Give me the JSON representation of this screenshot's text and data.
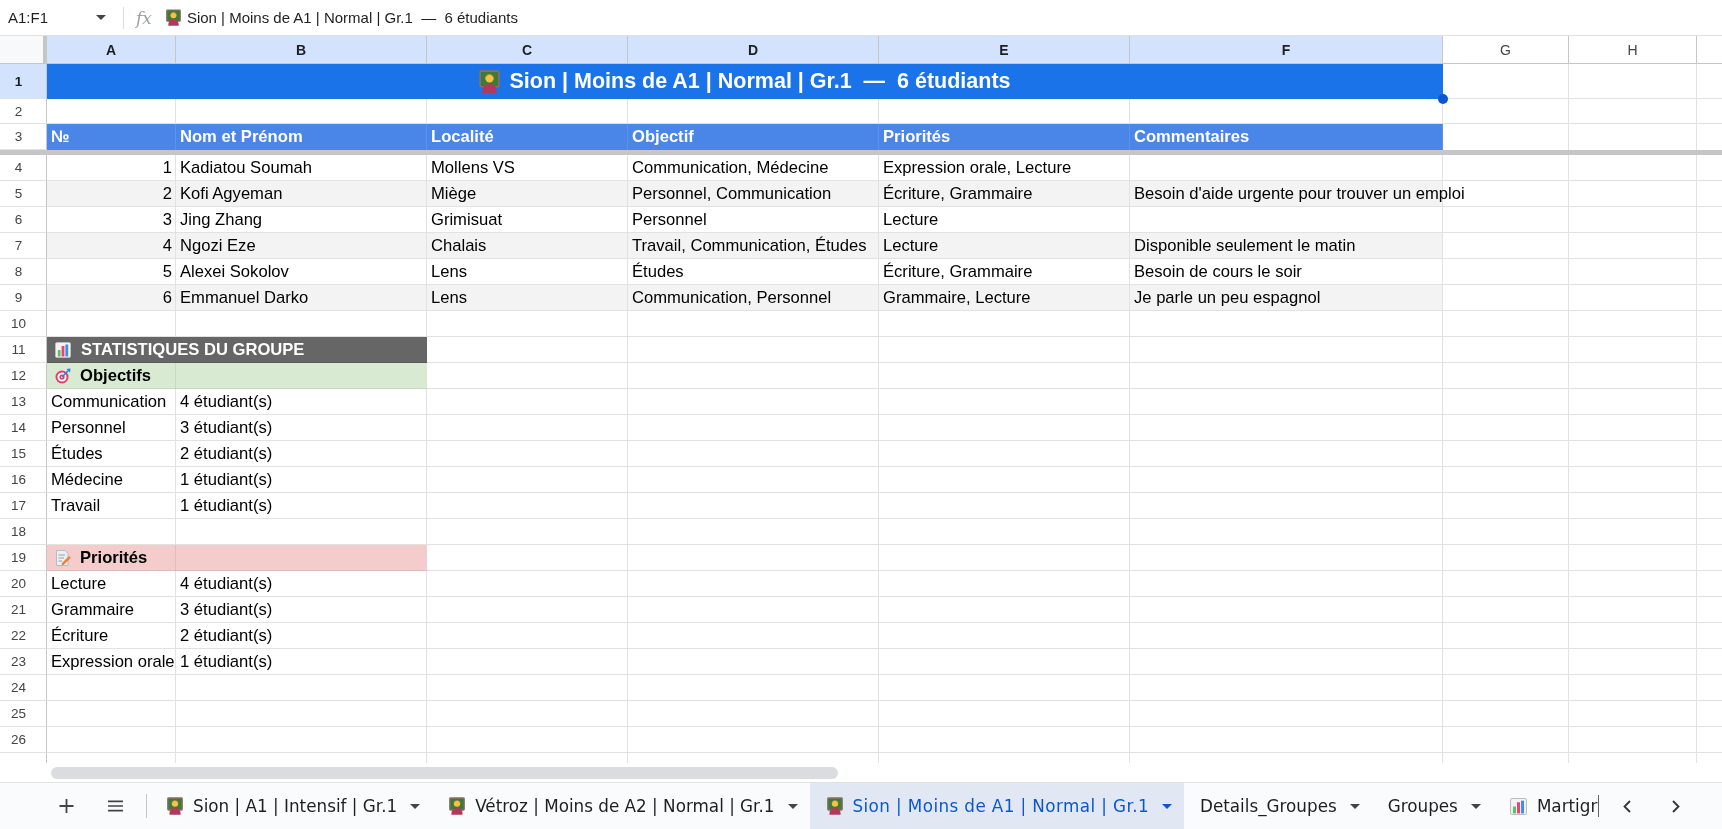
{
  "formula_bar": {
    "cell_reference": "A1:F1",
    "function_label": "fx",
    "content": "Sion | Moins de A1 | Normal | Gr.1  —  6 étudiants"
  },
  "column_headers": [
    {
      "label": "A",
      "selected": true
    },
    {
      "label": "B",
      "selected": true
    },
    {
      "label": "C",
      "selected": true
    },
    {
      "label": "D",
      "selected": true
    },
    {
      "label": "E",
      "selected": true
    },
    {
      "label": "F",
      "selected": true
    },
    {
      "label": "G",
      "selected": false
    },
    {
      "label": "H",
      "selected": false
    }
  ],
  "row_headers": [
    {
      "label": "1",
      "selected": true
    },
    {
      "label": "2",
      "selected": false
    },
    {
      "label": "3",
      "selected": false
    },
    {
      "label": "4",
      "selected": false
    },
    {
      "label": "5",
      "selected": false
    },
    {
      "label": "6",
      "selected": false
    },
    {
      "label": "7",
      "selected": false
    },
    {
      "label": "8",
      "selected": false
    },
    {
      "label": "9",
      "selected": false
    },
    {
      "label": "10",
      "selected": false
    },
    {
      "label": "11",
      "selected": false
    },
    {
      "label": "12",
      "selected": false
    },
    {
      "label": "13",
      "selected": false
    },
    {
      "label": "14",
      "selected": false
    },
    {
      "label": "15",
      "selected": false
    },
    {
      "label": "16",
      "selected": false
    },
    {
      "label": "17",
      "selected": false
    },
    {
      "label": "18",
      "selected": false
    },
    {
      "label": "19",
      "selected": false
    },
    {
      "label": "20",
      "selected": false
    },
    {
      "label": "21",
      "selected": false
    },
    {
      "label": "22",
      "selected": false
    },
    {
      "label": "23",
      "selected": false
    },
    {
      "label": "24",
      "selected": false
    },
    {
      "label": "25",
      "selected": false
    },
    {
      "label": "26",
      "selected": false
    }
  ],
  "title": "Sion | Moins de A1 | Normal | Gr.1  —  6 étudiants",
  "table": {
    "columns": [
      "№",
      "Nom et Prénom",
      "Localité",
      "Objectif",
      "Priorités",
      "Commentaires"
    ],
    "rows": [
      {
        "number": "1",
        "name": "Kadiatou Soumah",
        "locality": "Mollens VS",
        "objective": "Communication, Médecine",
        "priorities": "Expression orale, Lecture"
      },
      {
        "number": "2",
        "name": "Kofi Agyeman",
        "locality": "Miège",
        "objective": "Personnel, Communication",
        "priorities": "Écriture, Grammaire",
        "comment": "Besoin d'aide urgente pour trouver un emploi"
      },
      {
        "number": "3",
        "name": "Jing Zhang",
        "locality": "Grimisuat",
        "objective": "Personnel",
        "priorities": "Lecture"
      },
      {
        "number": "4",
        "name": "Ngozi Eze",
        "locality": "Chalais",
        "objective": "Travail, Communication, Études",
        "priorities": "Lecture",
        "comment": "Disponible seulement le matin"
      },
      {
        "number": "5",
        "name": "Alexei Sokolov",
        "locality": "Lens",
        "objective": "Études",
        "priorities": "Écriture, Grammaire",
        "comment": "Besoin de cours le soir"
      },
      {
        "number": "6",
        "name": "Emmanuel Darko",
        "locality": "Lens",
        "objective": "Communication, Personnel",
        "priorities": "Grammaire, Lecture",
        "comment": "Je parle un peu espagnol"
      }
    ]
  },
  "statistics": {
    "title": "STATISTIQUES DU GROUPE",
    "sections": [
      {
        "kind": "objectives",
        "title": "Objectifs",
        "color": "#d9ead3",
        "items": [
          {
            "label": "Communication",
            "count": "4 étudiant(s)"
          },
          {
            "label": "Personnel",
            "count": "3 étudiant(s)"
          },
          {
            "label": "Études",
            "count": "2 étudiant(s)"
          },
          {
            "label": "Médecine",
            "count": "1 étudiant(s)"
          },
          {
            "label": "Travail",
            "count": "1 étudiant(s)"
          }
        ]
      },
      {
        "kind": "priorities",
        "title": "Priorités",
        "color": "#f4cccc",
        "items": [
          {
            "label": "Lecture",
            "count": "4 étudiant(s)"
          },
          {
            "label": "Grammaire",
            "count": "3 étudiant(s)"
          },
          {
            "label": "Écriture",
            "count": "2 étudiant(s)"
          },
          {
            "label": "Expression orale",
            "count": "1 étudiant(s)"
          }
        ]
      }
    ]
  },
  "sheet_tabs": [
    {
      "label": "Sion | A1 | Intensif | Gr.1",
      "kind": "group",
      "selected": false,
      "dropdown": true
    },
    {
      "label": "Vétroz | Moins de A2 | Normal | Gr.1",
      "kind": "group",
      "selected": false,
      "dropdown": true
    },
    {
      "label": "Sion | Moins de A1 | Normal | Gr.1",
      "kind": "group",
      "selected": true,
      "dropdown": true
    },
    {
      "label": "Details_Groupes",
      "kind": "plain",
      "selected": false,
      "dropdown": true
    },
    {
      "label": "Groupes",
      "kind": "plain",
      "selected": false,
      "dropdown": true
    },
    {
      "label": "Martigr",
      "kind": "chart",
      "selected": false,
      "dropdown": false
    }
  ]
}
